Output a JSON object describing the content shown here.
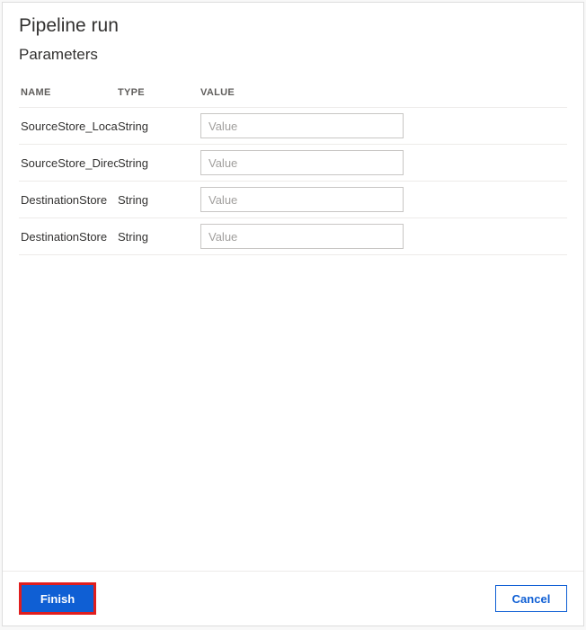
{
  "panel": {
    "title": "Pipeline run",
    "section_title": "Parameters"
  },
  "table": {
    "headers": {
      "name": "NAME",
      "type": "TYPE",
      "value": "VALUE"
    },
    "rows": [
      {
        "name": "SourceStore_Location",
        "type": "String",
        "value": "",
        "placeholder": "Value"
      },
      {
        "name": "SourceStore_Directory",
        "type": "String",
        "value": "",
        "placeholder": "Value"
      },
      {
        "name": "DestinationStore",
        "type": "String",
        "value": "",
        "placeholder": "Value"
      },
      {
        "name": "DestinationStore",
        "type": "String",
        "value": "",
        "placeholder": "Value"
      }
    ]
  },
  "footer": {
    "finish_label": "Finish",
    "cancel_label": "Cancel"
  }
}
